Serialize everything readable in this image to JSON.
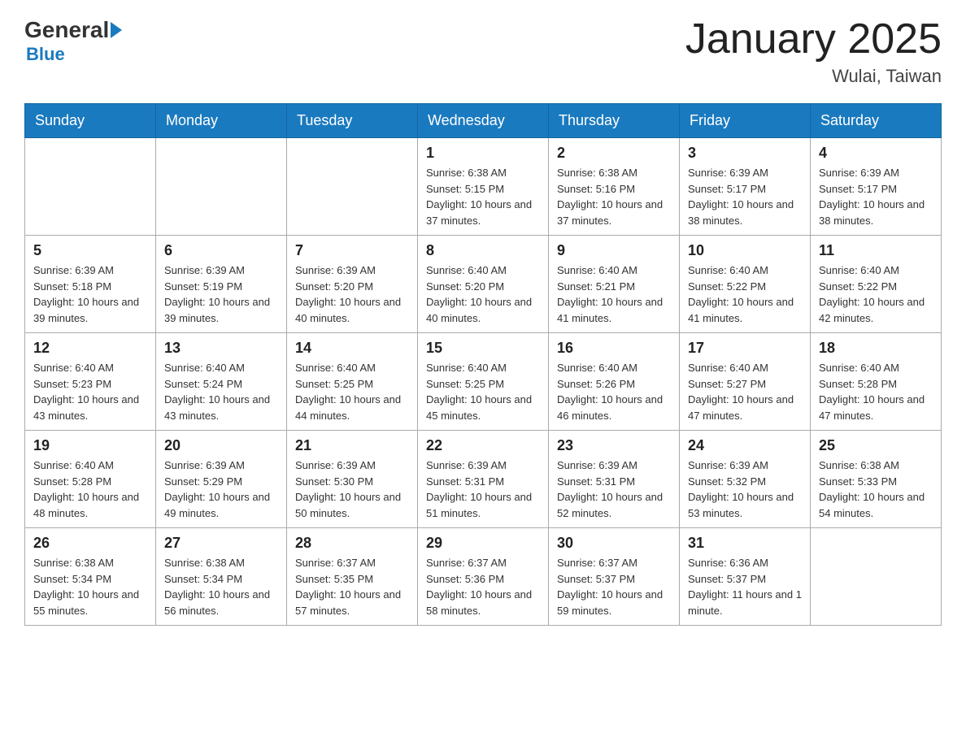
{
  "header": {
    "logo_general": "General",
    "logo_blue": "Blue",
    "title": "January 2025",
    "location": "Wulai, Taiwan"
  },
  "days_of_week": [
    "Sunday",
    "Monday",
    "Tuesday",
    "Wednesday",
    "Thursday",
    "Friday",
    "Saturday"
  ],
  "weeks": [
    [
      {
        "day": "",
        "info": ""
      },
      {
        "day": "",
        "info": ""
      },
      {
        "day": "",
        "info": ""
      },
      {
        "day": "1",
        "info": "Sunrise: 6:38 AM\nSunset: 5:15 PM\nDaylight: 10 hours and 37 minutes."
      },
      {
        "day": "2",
        "info": "Sunrise: 6:38 AM\nSunset: 5:16 PM\nDaylight: 10 hours and 37 minutes."
      },
      {
        "day": "3",
        "info": "Sunrise: 6:39 AM\nSunset: 5:17 PM\nDaylight: 10 hours and 38 minutes."
      },
      {
        "day": "4",
        "info": "Sunrise: 6:39 AM\nSunset: 5:17 PM\nDaylight: 10 hours and 38 minutes."
      }
    ],
    [
      {
        "day": "5",
        "info": "Sunrise: 6:39 AM\nSunset: 5:18 PM\nDaylight: 10 hours and 39 minutes."
      },
      {
        "day": "6",
        "info": "Sunrise: 6:39 AM\nSunset: 5:19 PM\nDaylight: 10 hours and 39 minutes."
      },
      {
        "day": "7",
        "info": "Sunrise: 6:39 AM\nSunset: 5:20 PM\nDaylight: 10 hours and 40 minutes."
      },
      {
        "day": "8",
        "info": "Sunrise: 6:40 AM\nSunset: 5:20 PM\nDaylight: 10 hours and 40 minutes."
      },
      {
        "day": "9",
        "info": "Sunrise: 6:40 AM\nSunset: 5:21 PM\nDaylight: 10 hours and 41 minutes."
      },
      {
        "day": "10",
        "info": "Sunrise: 6:40 AM\nSunset: 5:22 PM\nDaylight: 10 hours and 41 minutes."
      },
      {
        "day": "11",
        "info": "Sunrise: 6:40 AM\nSunset: 5:22 PM\nDaylight: 10 hours and 42 minutes."
      }
    ],
    [
      {
        "day": "12",
        "info": "Sunrise: 6:40 AM\nSunset: 5:23 PM\nDaylight: 10 hours and 43 minutes."
      },
      {
        "day": "13",
        "info": "Sunrise: 6:40 AM\nSunset: 5:24 PM\nDaylight: 10 hours and 43 minutes."
      },
      {
        "day": "14",
        "info": "Sunrise: 6:40 AM\nSunset: 5:25 PM\nDaylight: 10 hours and 44 minutes."
      },
      {
        "day": "15",
        "info": "Sunrise: 6:40 AM\nSunset: 5:25 PM\nDaylight: 10 hours and 45 minutes."
      },
      {
        "day": "16",
        "info": "Sunrise: 6:40 AM\nSunset: 5:26 PM\nDaylight: 10 hours and 46 minutes."
      },
      {
        "day": "17",
        "info": "Sunrise: 6:40 AM\nSunset: 5:27 PM\nDaylight: 10 hours and 47 minutes."
      },
      {
        "day": "18",
        "info": "Sunrise: 6:40 AM\nSunset: 5:28 PM\nDaylight: 10 hours and 47 minutes."
      }
    ],
    [
      {
        "day": "19",
        "info": "Sunrise: 6:40 AM\nSunset: 5:28 PM\nDaylight: 10 hours and 48 minutes."
      },
      {
        "day": "20",
        "info": "Sunrise: 6:39 AM\nSunset: 5:29 PM\nDaylight: 10 hours and 49 minutes."
      },
      {
        "day": "21",
        "info": "Sunrise: 6:39 AM\nSunset: 5:30 PM\nDaylight: 10 hours and 50 minutes."
      },
      {
        "day": "22",
        "info": "Sunrise: 6:39 AM\nSunset: 5:31 PM\nDaylight: 10 hours and 51 minutes."
      },
      {
        "day": "23",
        "info": "Sunrise: 6:39 AM\nSunset: 5:31 PM\nDaylight: 10 hours and 52 minutes."
      },
      {
        "day": "24",
        "info": "Sunrise: 6:39 AM\nSunset: 5:32 PM\nDaylight: 10 hours and 53 minutes."
      },
      {
        "day": "25",
        "info": "Sunrise: 6:38 AM\nSunset: 5:33 PM\nDaylight: 10 hours and 54 minutes."
      }
    ],
    [
      {
        "day": "26",
        "info": "Sunrise: 6:38 AM\nSunset: 5:34 PM\nDaylight: 10 hours and 55 minutes."
      },
      {
        "day": "27",
        "info": "Sunrise: 6:38 AM\nSunset: 5:34 PM\nDaylight: 10 hours and 56 minutes."
      },
      {
        "day": "28",
        "info": "Sunrise: 6:37 AM\nSunset: 5:35 PM\nDaylight: 10 hours and 57 minutes."
      },
      {
        "day": "29",
        "info": "Sunrise: 6:37 AM\nSunset: 5:36 PM\nDaylight: 10 hours and 58 minutes."
      },
      {
        "day": "30",
        "info": "Sunrise: 6:37 AM\nSunset: 5:37 PM\nDaylight: 10 hours and 59 minutes."
      },
      {
        "day": "31",
        "info": "Sunrise: 6:36 AM\nSunset: 5:37 PM\nDaylight: 11 hours and 1 minute."
      },
      {
        "day": "",
        "info": ""
      }
    ]
  ]
}
